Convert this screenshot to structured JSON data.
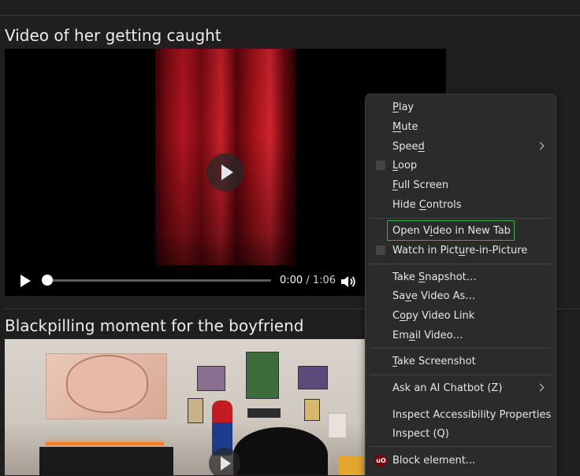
{
  "video1": {
    "title": "Video of her getting caught",
    "time_current": "0:00",
    "time_separator": " / ",
    "time_duration": "1:06",
    "progress_fraction": 0.0
  },
  "video2": {
    "title": "Blackpilling moment for the boyfriend"
  },
  "context_menu": {
    "items": [
      {
        "pre": "",
        "u": "P",
        "post": "lay"
      },
      {
        "pre": "",
        "u": "M",
        "post": "ute"
      },
      {
        "pre": "Spee",
        "u": "d",
        "post": "",
        "submenu": true
      },
      {
        "pre": "",
        "u": "L",
        "post": "oop",
        "checkbox": true
      },
      {
        "pre": "",
        "u": "F",
        "post": "ull Screen"
      },
      {
        "pre": "Hide ",
        "u": "C",
        "post": "ontrols"
      },
      {
        "pre": "Open V",
        "u": "i",
        "post": "deo in New Tab",
        "focused": true
      },
      {
        "pre": "Watch in Pict",
        "u": "u",
        "post": "re-in-Picture",
        "checkbox": true
      },
      {
        "pre": "Take ",
        "u": "S",
        "post": "napshot…"
      },
      {
        "pre": "Sa",
        "u": "v",
        "post": "e Video As…"
      },
      {
        "pre": "C",
        "u": "o",
        "post": "py Video Link"
      },
      {
        "pre": "Em",
        "u": "a",
        "post": "il Video…"
      },
      {
        "pre": "",
        "u": "T",
        "post": "ake Screenshot"
      },
      {
        "pre": "Ask an AI Chatbot (Z)",
        "u": "",
        "post": "",
        "submenu": true
      },
      {
        "pre": "Inspect Accessibility Properties",
        "u": "",
        "post": ""
      },
      {
        "pre": "Inspect (Q)",
        "u": "",
        "post": ""
      },
      {
        "pre": "Block element...",
        "u": "",
        "post": "",
        "icon": "ublock-origin-icon",
        "icon_text": "uO"
      }
    ]
  },
  "colors": {
    "page_bg": "#1f1f1f",
    "menu_bg": "#2b2b2b",
    "focus_outline": "#2fb24a",
    "curtain_red": "#b01520"
  }
}
